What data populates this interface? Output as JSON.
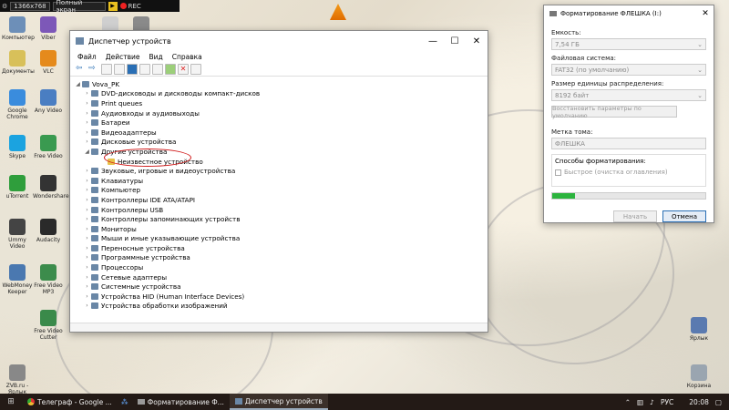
{
  "recorder": {
    "resolution": "1366x768",
    "mode": "Полный экран",
    "rec": "REC"
  },
  "desktop_icons": [
    {
      "label": "Компьютер",
      "color": "#6d8fb8"
    },
    {
      "label": "Viber",
      "color": "#7d58b8"
    },
    {
      "label": "Флеш",
      "color": "#cfcfcf"
    },
    {
      "label": "Видео",
      "color": "#8a8a8a"
    },
    {
      "label": "Документы",
      "color": "#d8c05a"
    },
    {
      "label": "VLC",
      "color": "#e58a1c"
    },
    {
      "label": "Google Chrome",
      "color": "#3a8cdd"
    },
    {
      "label": "Any Video",
      "color": "#4a7ec2"
    },
    {
      "label": "Skype",
      "color": "#1ba3e0"
    },
    {
      "label": "Free Video",
      "color": "#3a9a50"
    },
    {
      "label": "uTorrent",
      "color": "#2f9e3c"
    },
    {
      "label": "Wondershare",
      "color": "#333333"
    },
    {
      "label": "Ummy Video",
      "color": "#444444"
    },
    {
      "label": "Audacity",
      "color": "#2a2a2a"
    },
    {
      "label": "WebMoney Keeper",
      "color": "#4a78b0"
    },
    {
      "label": "Free Video MP3",
      "color": "#3c8c4c"
    },
    {
      "label": "Free Video Cutter",
      "color": "#3a8a4a"
    },
    {
      "label": "ZVB.ru - Ярлык",
      "color": "#888888"
    },
    {
      "label": "Корзина",
      "color": "#9aa5b0"
    },
    {
      "label": "Ярлык",
      "color": "#5a7ab0"
    }
  ],
  "devmgr": {
    "title": "Диспетчер устройств",
    "menu": [
      "Файл",
      "Действие",
      "Вид",
      "Справка"
    ],
    "root": "Vova_PK",
    "items": [
      "DVD-дисководы и дисководы компакт-дисков",
      "Print queues",
      "Аудиовходы и аудиовыходы",
      "Батареи",
      "Видеоадаптеры",
      "Дисковые устройства",
      "Другие устройства",
      "Неизвестное устройство",
      "Звуковые, игровые и видеоустройства",
      "Клавиатуры",
      "Компьютер",
      "Контроллеры IDE ATA/ATAPI",
      "Контроллеры USB",
      "Контроллеры запоминающих устройств",
      "Мониторы",
      "Мыши и иные указывающие устройства",
      "Переносные устройства",
      "Программные устройства",
      "Процессоры",
      "Сетевые адаптеры",
      "Системные устройства",
      "Устройства HID (Human Interface Devices)",
      "Устройства обработки изображений"
    ]
  },
  "format": {
    "title": "Форматирование ФЛЕШКА (I:)",
    "capacity_label": "Емкость:",
    "capacity": "7,54 ГБ",
    "fs_label": "Файловая система:",
    "fs": "FAT32 (по умолчанию)",
    "alloc_label": "Размер единицы распределения:",
    "alloc": "8192 байт",
    "restore": "Восстановить параметры по умолчанию",
    "volume_label": "Метка тома:",
    "volume": "ФЛЕШКА",
    "options_label": "Способы форматирования:",
    "quick": "Быстрое (очистка оглавления)",
    "progress": 0.15,
    "start": "Начать",
    "cancel": "Отмена"
  },
  "taskbar": {
    "tasks": [
      "Телеграф - Google ...",
      "Форматирование Ф...",
      "Диспетчер устройств"
    ],
    "lang": "РУС",
    "time": "20:08"
  }
}
